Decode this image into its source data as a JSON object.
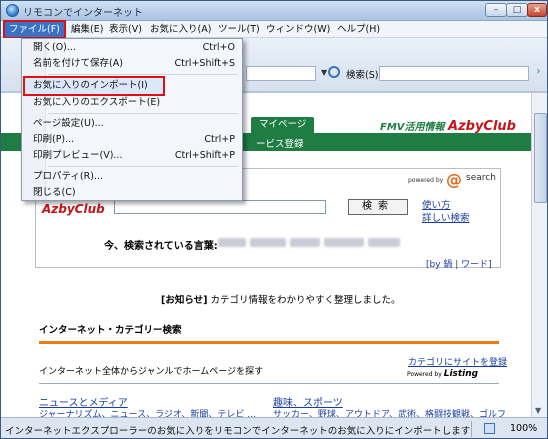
{
  "window": {
    "title": "リモコンでインターネット",
    "buttons": {
      "minimize": "–",
      "maximize": "□",
      "close": "x"
    }
  },
  "menubar": [
    {
      "label": "ファイル(F)",
      "active": true
    },
    {
      "label": "編集(E)"
    },
    {
      "label": "表示(V)"
    },
    {
      "label": "お気に入り(A)"
    },
    {
      "label": "ツール(T)"
    },
    {
      "label": "ウィンドウ(W)"
    },
    {
      "label": "ヘルプ(H)"
    }
  ],
  "toolbar": {
    "search_label": "検索(S)",
    "address_dropdown_icon": "chevron-down-icon",
    "search_icon": "search-icon",
    "go_icon": "chevron-right-icon"
  },
  "file_menu": {
    "items": [
      {
        "label": "開く(O)...",
        "shortcut": "Ctrl+O"
      },
      {
        "label": "名前を付けて保存(A)",
        "shortcut": "Ctrl+Shift+S"
      },
      {
        "label": "お気に入りのインポート(I)",
        "shortcut": "",
        "highlighted": true
      },
      {
        "label": "お気に入りのエクスポート(E)",
        "shortcut": ""
      },
      {
        "label": "ページ設定(U)...",
        "shortcut": ""
      },
      {
        "label": "印刷(P)...",
        "shortcut": "Ctrl+P"
      },
      {
        "label": "印刷プレビュー(V)...",
        "shortcut": "Ctrl+Shift+P"
      },
      {
        "label": "プロパティ(R)...",
        "shortcut": ""
      },
      {
        "label": "閉じる(C)",
        "shortcut": ""
      }
    ]
  },
  "site": {
    "mypage_tab": "マイページ",
    "brand_prefix": "FMV活用情報",
    "brand_name": "AzbyClub",
    "service_label": "ービス登録",
    "search_panel": {
      "powered_by": "powered by",
      "search_brand": "search",
      "logo": "AzbyClub",
      "search_button": "検索",
      "help_link": "使い方",
      "advanced_link": "詳しい検索",
      "current_words_label": "今、検索されている言葉:",
      "by_words": "[by 鍋 | ワード]"
    },
    "notice_prefix": "[お知らせ]",
    "notice_text": " カテゴリ情報をわかりやすく整理しました。",
    "category": {
      "title": "インターネット・カテゴリー検索",
      "description": "インターネット全体からジャンルでホームページを探す",
      "register_link": "カテゴリにサイトを登録",
      "powered_by": "Powered by",
      "powered_brand": "Listing",
      "news_title": "ニュースとメディア",
      "news_sub": "ジャーナリズム、ニュース、ラジオ、新聞、テレビ …",
      "hobby_title": "趣味、スポーツ",
      "hobby_sub": "サッカー、野球、アウトドア、武術、格闘技観戦、ゴルフ"
    }
  },
  "statusbar": {
    "text": "インターネットエクスプローラーのお気に入りをリモコンでインターネットのお気に入りにインポートします",
    "zoom": "100%"
  },
  "colors": {
    "highlight_red": "#e01010",
    "site_green": "#1f7d43",
    "brand_red": "#c5151b",
    "link_blue": "#1b3fa0",
    "orange": "#f07a1a"
  }
}
